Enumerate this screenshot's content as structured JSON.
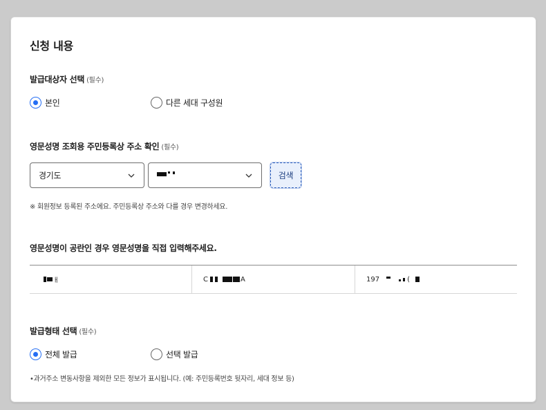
{
  "section_title": "신청 내용",
  "target": {
    "label": "발급대상자 선택",
    "required": "(필수)",
    "options": [
      {
        "label": "본인",
        "selected": true
      },
      {
        "label": "다른 세대 구성원",
        "selected": false
      }
    ]
  },
  "address": {
    "label": "영문성명 조회용 주민등록상 주소 확인",
    "required": "(필수)",
    "province": "경기도",
    "city": "",
    "search_label": "검색",
    "note": "※ 회원정보 등록된 주소에요. 주민등록상 주소와 다를 경우 변경하세요."
  },
  "name_section": {
    "label": "영문성명이 공란인 경우 영문성명을 직접 입력해주세요.",
    "cells": [
      "",
      "C",
      "197"
    ]
  },
  "issue_type": {
    "label": "발급형태 선택",
    "required": "(필수)",
    "options": [
      {
        "label": "전체 발급",
        "selected": true
      },
      {
        "label": "선택 발급",
        "selected": false
      }
    ],
    "note": "•과거주소 변동사항을 제외한 모든 정보가 표시됩니다. (예: 주민등록번호 뒷자리, 세대 정보 등)"
  },
  "colors": {
    "accent": "#256ef4",
    "search_bg": "#e9f0fc"
  }
}
